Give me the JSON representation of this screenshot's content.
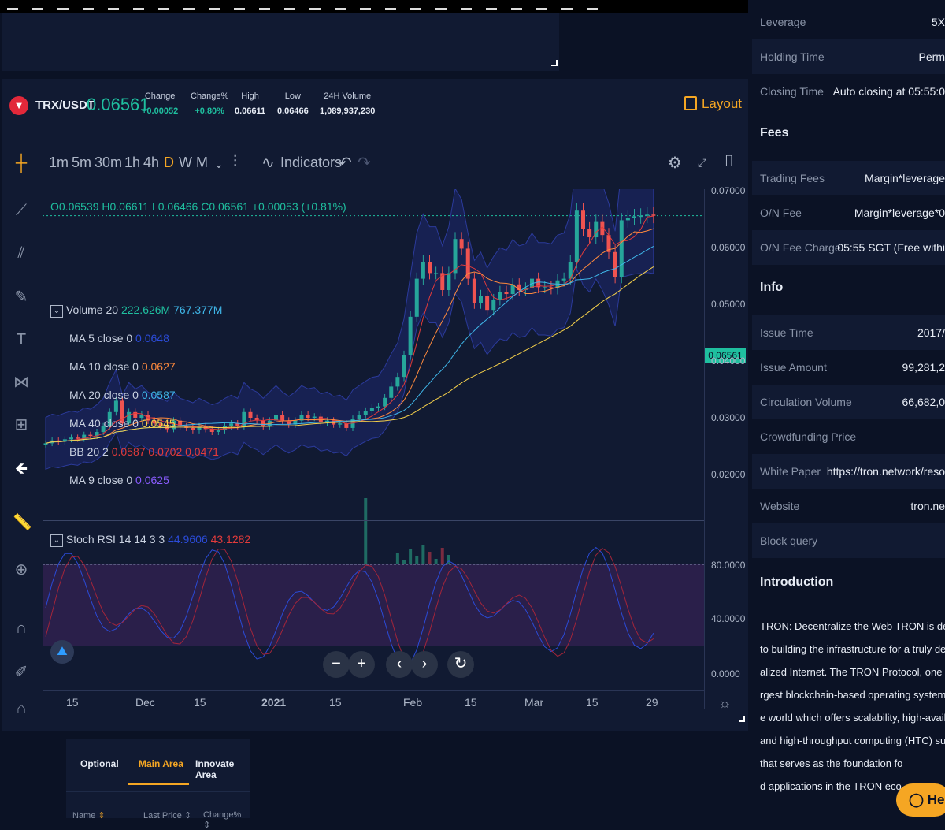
{
  "ticker": {
    "pair": "TRX/USDT",
    "price": "0.06561",
    "stats": [
      {
        "label": "Change",
        "value": "+0.00052",
        "up": true
      },
      {
        "label": "Change%",
        "value": "+0.80%",
        "up": true
      },
      {
        "label": "High",
        "value": "0.06611",
        "up": false
      },
      {
        "label": "Low",
        "value": "0.06466",
        "up": false
      },
      {
        "label": "24H Volume",
        "value": "1,089,937,230",
        "up": false
      }
    ],
    "layout_label": "Layout"
  },
  "toolbar": {
    "intervals": [
      "1m",
      "5m",
      "30m",
      "1h",
      "4h",
      "D",
      "W",
      "M"
    ],
    "active_interval": "D",
    "indicators_label": "Indicators"
  },
  "legend": {
    "ohlc": "O0.06539  H0.06611  L0.06466  C0.06561  +0.00053 (+0.81%)",
    "volume": {
      "label": "Volume 20",
      "v1": "222.626M",
      "v2": "767.377M"
    },
    "mas": [
      {
        "label": "MA 5 close 0",
        "value": "0.0648",
        "color": "#2b4bd8"
      },
      {
        "label": "MA 10 close 0",
        "value": "0.0627",
        "color": "#ff8a3d"
      },
      {
        "label": "MA 20 close 0",
        "value": "0.0587",
        "color": "#3fb6e8"
      },
      {
        "label": "MA 40 close 0",
        "value": "0.0545",
        "color": "#f5d04a"
      },
      {
        "label": "BB 20 2",
        "value": "0.0587  0.0702  0.0471",
        "color": "#e23b3b"
      },
      {
        "label": "MA 9 close 0",
        "value": "0.0625",
        "color": "#8a5cff"
      }
    ],
    "rsi": {
      "label": "Stoch RSI 14 14 3 3",
      "v1": "44.9606",
      "v2": "43.1282"
    }
  },
  "price_axis": [
    "0.07000",
    "0.06000",
    "0.05000",
    "0.04000",
    "0.03000",
    "0.02000"
  ],
  "current_price_tag": "0.06561",
  "rsi_axis": [
    "80.0000",
    "40.0000",
    "0.0000"
  ],
  "time_axis": [
    "15",
    "Dec",
    "15",
    "2021",
    "15",
    "Feb",
    "15",
    "Mar",
    "15",
    "29"
  ],
  "chart_data": {
    "type": "candlestick",
    "close": [
      0.0255,
      0.026,
      0.0258,
      0.0262,
      0.0265,
      0.0263,
      0.027,
      0.0268,
      0.0275,
      0.0285,
      0.031,
      0.033,
      0.029,
      0.031,
      0.03,
      0.0305,
      0.0295,
      0.029,
      0.0285,
      0.028,
      0.0295,
      0.0285,
      0.0282,
      0.0278,
      0.0285,
      0.028,
      0.0275,
      0.0278,
      0.0285,
      0.029,
      0.0285,
      0.031,
      0.03,
      0.0295,
      0.0285,
      0.0295,
      0.0305,
      0.0295,
      0.0288,
      0.0295,
      0.0305,
      0.03,
      0.0302,
      0.0292,
      0.0295,
      0.0288,
      0.029,
      0.0282,
      0.0298,
      0.0305,
      0.0312,
      0.0318,
      0.032,
      0.0335,
      0.0355,
      0.0372,
      0.041,
      0.0478,
      0.0545,
      0.0575,
      0.0555,
      0.0555,
      0.0525,
      0.0555,
      0.0615,
      0.0598,
      0.0545,
      0.0502,
      0.0515,
      0.049,
      0.0508,
      0.0522,
      0.0518,
      0.0535,
      0.0525,
      0.0528,
      0.0545,
      0.053,
      0.053,
      0.0528,
      0.0542,
      0.0545,
      0.0575,
      0.0665,
      0.0632,
      0.0618,
      0.0645,
      0.0622,
      0.0592,
      0.0548,
      0.0648,
      0.0652,
      0.0655,
      0.0656,
      0.0658,
      0.0656
    ]
  },
  "right_panel": {
    "rows_top": [
      {
        "k": "Leverage",
        "v": "5X"
      },
      {
        "k": "Holding Time",
        "v": "Perm"
      },
      {
        "k": "Closing Time",
        "v": "Auto closing at 05:55:0"
      }
    ],
    "fees_head": "Fees",
    "rows_fees": [
      {
        "k": "Trading Fees",
        "v": "Margin*leverage"
      },
      {
        "k": "O/N Fee",
        "v": "Margin*leverage*0"
      },
      {
        "k": "O/N Fee Charge",
        "v": "05:55 SGT (Free withi"
      }
    ],
    "info_head": "Info",
    "rows_info": [
      {
        "k": "Issue Time",
        "v": "2017/"
      },
      {
        "k": "Issue Amount",
        "v": "99,281,2"
      },
      {
        "k": "Circulation Volume",
        "v": "66,682,0"
      },
      {
        "k": "Crowdfunding Price",
        "v": ""
      },
      {
        "k": "White Paper",
        "v": "https://tron.network/reso"
      },
      {
        "k": "Website",
        "v": "tron.ne"
      },
      {
        "k": "Block query",
        "v": ""
      }
    ],
    "intro_head": "Introduction",
    "intro_text": "TRON: Decentralize the Web TRON is dedi\nto building the infrastructure for a truly de\nalized Internet. The TRON Protocol, one of\nrgest blockchain-based operating systems\ne world which offers scalability, high-availa\nand high-throughput computing (HTC) sup\nthat serves as the foundation fo\nd applications in the TRON eco",
    "help_label": "He"
  },
  "market": {
    "tabs": [
      "Optional",
      "Main Area",
      "Innovate Area"
    ],
    "active_tab": "Main Area",
    "columns": [
      "Name",
      "Last Price",
      "Change%"
    ]
  }
}
